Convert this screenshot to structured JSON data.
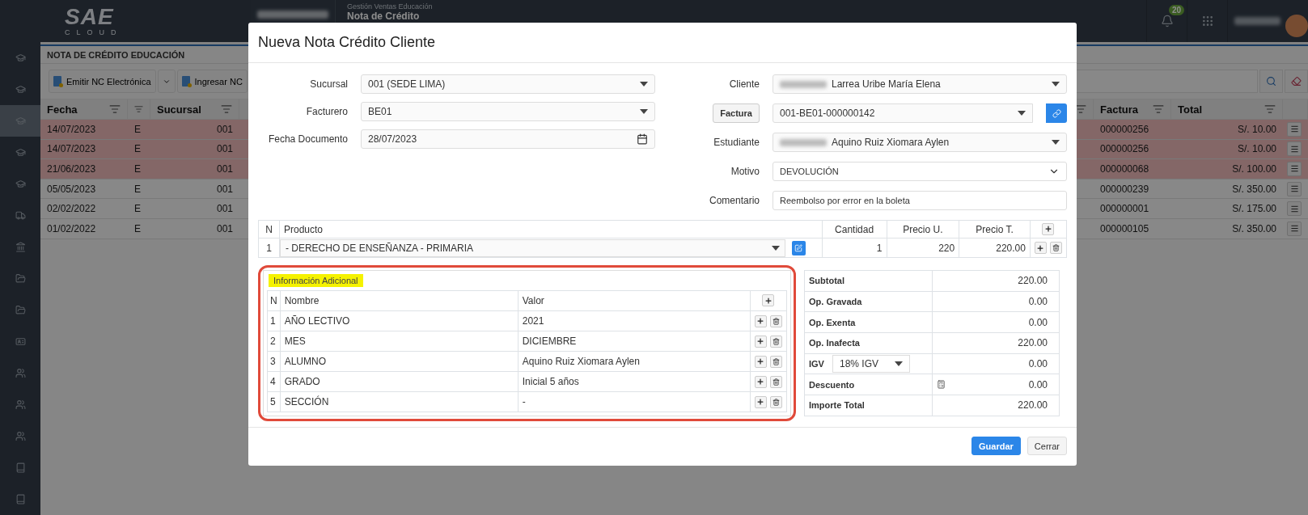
{
  "topbar": {
    "logo": "SAE",
    "logo_sub": "CLOUD",
    "module": "Gestión Ventas Educación",
    "page": "Nota de Crédito",
    "notifications": "20"
  },
  "sidebar": {
    "items": [
      {
        "kind": "cap",
        "selected": false
      },
      {
        "kind": "cap",
        "selected": false
      },
      {
        "kind": "cap",
        "selected": true
      },
      {
        "kind": "cap",
        "selected": false
      },
      {
        "kind": "cap",
        "selected": false
      },
      {
        "kind": "truck",
        "selected": false
      },
      {
        "kind": "bank",
        "selected": false
      },
      {
        "kind": "folder",
        "selected": false
      },
      {
        "kind": "folder",
        "selected": false
      },
      {
        "kind": "card",
        "selected": false
      },
      {
        "kind": "users",
        "selected": false
      },
      {
        "kind": "users",
        "selected": false
      },
      {
        "kind": "users",
        "selected": false
      },
      {
        "kind": "book",
        "selected": false
      },
      {
        "kind": "book",
        "selected": false
      }
    ]
  },
  "list": {
    "title": "NOTA DE CRÉDITO EDUCACIÓN",
    "actions": [
      "Emitir NC Electrónica",
      "Ingresar NC"
    ],
    "columns": {
      "fecha": "Fecha",
      "sucursal": "Sucursal",
      "factura": "Factura",
      "total": "Total"
    },
    "rows": [
      {
        "fecha": "14/07/2023",
        "column_2": "E",
        "sucursal": "001",
        "factura": "000000256",
        "total": "S/. 10.00",
        "highlighted": true
      },
      {
        "fecha": "14/07/2023",
        "column_2": "E",
        "sucursal": "001",
        "factura": "000000256",
        "total": "S/. 10.00",
        "highlighted": true
      },
      {
        "fecha": "21/06/2023",
        "column_2": "E",
        "sucursal": "001",
        "factura": "000000068",
        "total": "S/. 100.00",
        "highlighted": true
      },
      {
        "fecha": "05/05/2023",
        "column_2": "E",
        "sucursal": "001",
        "factura": "000000239",
        "total": "S/. 350.00",
        "highlighted": false
      },
      {
        "fecha": "02/02/2022",
        "column_2": "E",
        "sucursal": "001",
        "factura": "000000001",
        "total": "S/. 175.00",
        "highlighted": false
      },
      {
        "fecha": "01/02/2022",
        "column_2": "E",
        "sucursal": "001",
        "factura": "000000105",
        "total": "S/. 350.00",
        "highlighted": false
      }
    ]
  },
  "modal": {
    "title": "Nueva Nota Crédito Cliente",
    "left_fields": [
      {
        "label": "Sucursal",
        "value": "001 (SEDE LIMA)",
        "kind": "select"
      },
      {
        "label": "Facturero",
        "value": "BE01",
        "kind": "select"
      },
      {
        "label": "Fecha Documento",
        "value": "28/07/2023",
        "kind": "date"
      }
    ],
    "right_fields": [
      {
        "label": "Cliente",
        "value": "Larrea Uribe María Elena",
        "kind": "select",
        "masked": true
      },
      {
        "label": "Factura",
        "value": "001-BE01-000000142",
        "kind": "linked",
        "masked": false
      },
      {
        "label": "Estudiante",
        "value": "Aquino Ruiz Xiomara Aylen",
        "kind": "select",
        "masked": true
      },
      {
        "label": "Motivo",
        "value": "DEVOLUCIÓN",
        "kind": "native",
        "masked": false
      },
      {
        "label": "Comentario",
        "value": "Reembolso por error en la boleta",
        "kind": "text",
        "masked": false
      }
    ],
    "products": {
      "columns": [
        "N",
        "Producto",
        "Cantidad",
        "Precio U.",
        "Precio T."
      ],
      "rows": [
        {
          "n": "1",
          "producto": "- DERECHO DE ENSEÑANZA - PRIMARIA",
          "cantidad": "1",
          "precio_u": "220",
          "precio_t": "220.00"
        }
      ]
    },
    "additional_info": {
      "title": "Información Adicional",
      "columns": [
        "N",
        "Nombre",
        "Valor"
      ],
      "rows": [
        {
          "n": "1",
          "nombre": "AÑO LECTIVO",
          "valor": "2021"
        },
        {
          "n": "2",
          "nombre": "MES",
          "valor": "DICIEMBRE"
        },
        {
          "n": "3",
          "nombre": "ALUMNO",
          "valor": "Aquino Ruiz Xiomara Aylen"
        },
        {
          "n": "4",
          "nombre": "GRADO",
          "valor": "Inicial 5 años"
        },
        {
          "n": "5",
          "nombre": "SECCIÓN",
          "valor": "-"
        }
      ]
    },
    "totals": [
      {
        "label": "Subtotal",
        "value": "220.00",
        "kind": "plain"
      },
      {
        "label": "Op. Gravada",
        "value": "0.00",
        "kind": "plain"
      },
      {
        "label": "Op. Exenta",
        "value": "0.00",
        "kind": "plain"
      },
      {
        "label": "Op. Inafecta",
        "value": "220.00",
        "kind": "plain"
      },
      {
        "label": "IGV",
        "option": "18% IGV",
        "value": "0.00",
        "kind": "select"
      },
      {
        "label": "Descuento",
        "value": "0.00",
        "kind": "calc"
      },
      {
        "label": "Importe Total",
        "value": "220.00",
        "kind": "plain"
      }
    ],
    "buttons": [
      {
        "label": "Guardar",
        "kind": "primary"
      },
      {
        "label": "Cerrar",
        "kind": "default"
      }
    ]
  }
}
